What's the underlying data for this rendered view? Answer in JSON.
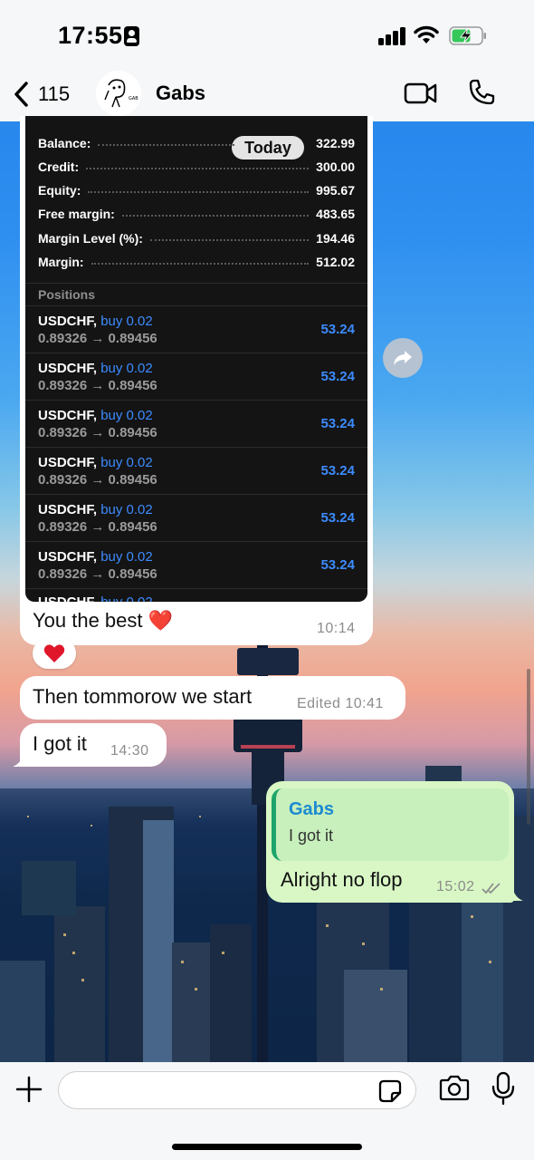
{
  "status_bar": {
    "time": "17:55"
  },
  "header": {
    "back_count": "115",
    "contact_name": "Gabs"
  },
  "screenshot": {
    "today": "Today",
    "account": [
      {
        "label": "Balance:",
        "value": "322.99"
      },
      {
        "label": "Credit:",
        "value": "300.00"
      },
      {
        "label": "Equity:",
        "value": "995.67"
      },
      {
        "label": "Free margin:",
        "value": "483.65"
      },
      {
        "label": "Margin Level (%):",
        "value": "194.46"
      },
      {
        "label": "Margin:",
        "value": "512.02"
      }
    ],
    "positions_label": "Positions",
    "positions": [
      {
        "symbol": "USDCHF,",
        "side": "buy 0.02",
        "prices": "0.89326 → 0.89456",
        "profit": "53.24"
      },
      {
        "symbol": "USDCHF,",
        "side": "buy 0.02",
        "prices": "0.89326 → 0.89456",
        "profit": "53.24"
      },
      {
        "symbol": "USDCHF,",
        "side": "buy 0.02",
        "prices": "0.89326 → 0.89456",
        "profit": "53.24"
      },
      {
        "symbol": "USDCHF,",
        "side": "buy 0.02",
        "prices": "0.89326 → 0.89456",
        "profit": "53.24"
      },
      {
        "symbol": "USDCHF,",
        "side": "buy 0.02",
        "prices": "0.89326 → 0.89456",
        "profit": "53.24"
      },
      {
        "symbol": "USDCHF,",
        "side": "buy 0.02",
        "prices": "0.89326 → 0.89456",
        "profit": "53.24"
      },
      {
        "symbol": "USDCHF,",
        "side": "buy 0.02",
        "prices": "",
        "profit": ""
      }
    ]
  },
  "messages": [
    {
      "text": "You the best ❤️",
      "time": "10:14"
    },
    {
      "text": "Then tommorow we start",
      "time": "Edited 10:41"
    },
    {
      "text": "I got it",
      "time": "14:30"
    },
    {
      "text": "Alright no flop",
      "time": "15:02",
      "quote_name": "Gabs",
      "quote_text": "I got it"
    }
  ],
  "reaction": "❤️",
  "input": {
    "placeholder": ""
  },
  "colors": {
    "accent_blue": "#3d8bfd",
    "outgoing_bubble": "#d8f7c5",
    "quote_bar": "#1ea46a",
    "quote_name": "#1c8ad1"
  }
}
